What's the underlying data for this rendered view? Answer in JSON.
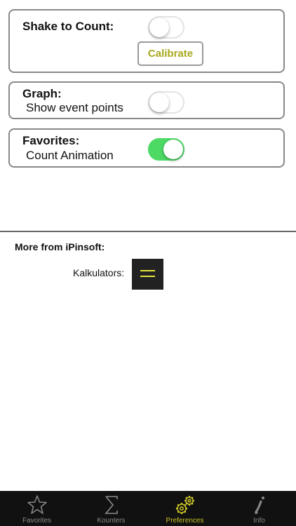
{
  "settings": {
    "shake": {
      "title": "Shake to Count:",
      "toggle_on": false,
      "calibrate_label": "Calibrate"
    },
    "graph": {
      "title": "Graph:",
      "subtitle": "Show event points",
      "toggle_on": false
    },
    "favorites": {
      "title": "Favorites:",
      "subtitle": "Count Animation",
      "toggle_on": true
    }
  },
  "more": {
    "title": "More from iPinsoft:",
    "kalkulators_label": "Kalkulators:",
    "kalkulators_icon": "equals-icon"
  },
  "tabs": [
    {
      "label": "Favorites",
      "icon": "star-icon",
      "active": false
    },
    {
      "label": "Kounters",
      "icon": "sigma-icon",
      "active": false
    },
    {
      "label": "Preferences",
      "icon": "gears-icon",
      "active": true
    },
    {
      "label": "Info",
      "icon": "info-icon",
      "active": false
    }
  ],
  "colors": {
    "toggle_on": "#4cd964",
    "accent": "#c9c327",
    "calibrate_text": "#a7a81c",
    "tabbar_bg": "#111111"
  }
}
